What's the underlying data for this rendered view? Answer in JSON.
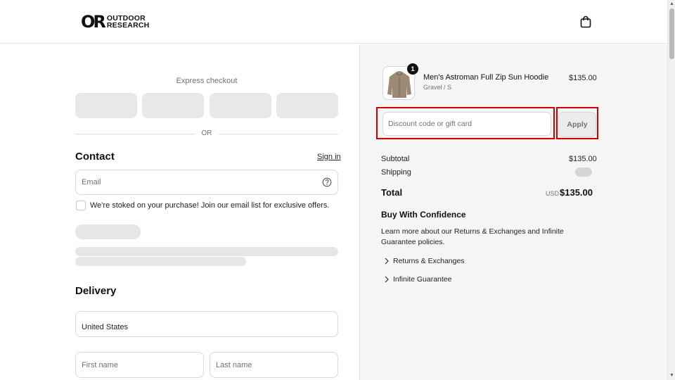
{
  "header": {
    "logo_mark": "OR",
    "logo_line1": "OUTDOOR",
    "logo_line2": "RESEARCH",
    "cart_icon": "shopping-bag-icon"
  },
  "express_checkout": {
    "label": "Express checkout",
    "divider_text": "OR"
  },
  "contact": {
    "title": "Contact",
    "signin_label": "Sign in",
    "email_placeholder": "Email",
    "help_icon": "question-circle-icon",
    "newsletter_label": "We're stoked on your purchase! Join our email list for exclusive offers."
  },
  "delivery": {
    "title": "Delivery",
    "country_value": "United States",
    "first_name_placeholder": "First name",
    "last_name_placeholder": "Last name"
  },
  "order_summary": {
    "item": {
      "name": "Men's Astroman Full Zip Sun Hoodie",
      "variant": "Gravel / S",
      "price": "$135.00",
      "quantity": "1"
    },
    "discount_placeholder": "Discount code or gift card",
    "apply_label": "Apply",
    "subtotal_label": "Subtotal",
    "subtotal_value": "$135.00",
    "shipping_label": "Shipping",
    "total_label": "Total",
    "total_currency": "USD",
    "total_value": "$135.00"
  },
  "confidence": {
    "title": "Buy With Confidence",
    "text": "Learn more about our Returns & Exchanges and Infinite Guarantee policies.",
    "links": [
      "Returns & Exchanges",
      "Infinite Guarantee"
    ]
  },
  "colors": {
    "highlight": "#d40000",
    "panel_bg": "#f5f5f5",
    "skeleton": "#e6e6e6"
  }
}
